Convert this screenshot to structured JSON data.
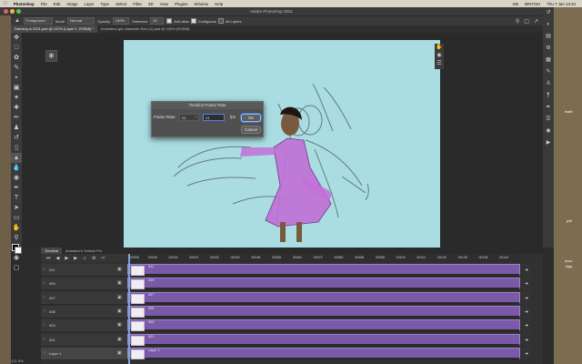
{
  "menubar": {
    "apple": "",
    "items": [
      "Photoshop",
      "File",
      "Edit",
      "Image",
      "Layer",
      "Type",
      "Select",
      "Filter",
      "3D",
      "View",
      "Plugins",
      "Window",
      "Help"
    ],
    "right": [
      "GB",
      "BRITISH",
      "Thu 7 Jan 13:34"
    ]
  },
  "window": {
    "title": "Adobe Photoshop 2021"
  },
  "options": {
    "preset": "Foreground",
    "mode_label": "Mode:",
    "mode_value": "Normal",
    "opacity_label": "Opacity:",
    "opacity_value": "100%",
    "tolerance_label": "Tolerance:",
    "tolerance_value": "32",
    "antialias": "Anti-alias",
    "contiguous": "Contiguous",
    "all_layers": "All Layers"
  },
  "doc_tabs": [
    {
      "label": "Dancing in 2021.psd @ 122% (Layer 1, RGB/8) *"
    },
    {
      "label": "Animation girl-character-Recl (1).psd @ 100% (RGB/8)"
    }
  ],
  "dialog": {
    "title": "Timeline Frame Rate",
    "frame_rate_label": "Frame Rate:",
    "frame_rate_value": "24",
    "fps_value": "24",
    "fps_label": "fps",
    "ok": "OK",
    "cancel": "Cancel"
  },
  "timeline": {
    "tabs": [
      "Timeline",
      "Animator's Toolbar Pro"
    ],
    "ruler": [
      "00000",
      "00008",
      "00016",
      "00024",
      "00032",
      "00040",
      "00048",
      "00056",
      "00064",
      "00072",
      "00080",
      "00088",
      "00096",
      "00104",
      "00112",
      "00120",
      "00128",
      "00136",
      "00144"
    ],
    "layers": [
      "011",
      "009",
      "007",
      "005",
      "003",
      "001",
      "Layer 1"
    ]
  },
  "status": {
    "zoom": "121.9%"
  },
  "desktop_labels": [
    "leate",
    "pdf",
    "docx",
    "ings"
  ]
}
